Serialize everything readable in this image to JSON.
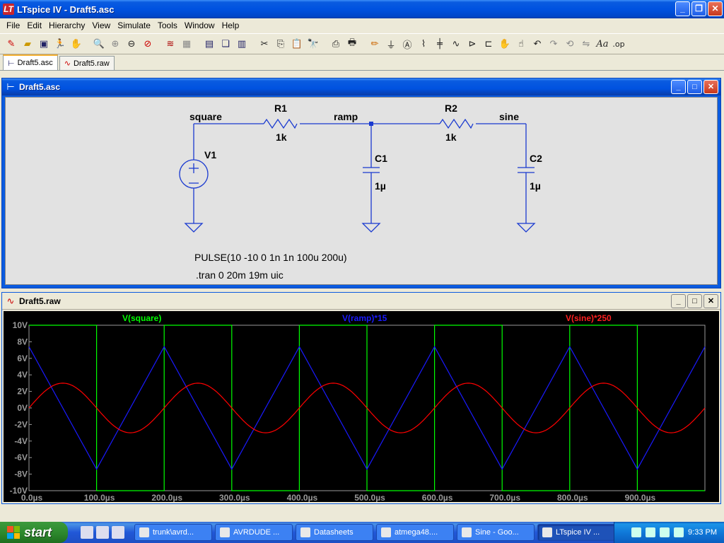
{
  "window": {
    "title": "LTspice IV - Draft5.asc",
    "logo": "LT"
  },
  "menu": [
    "File",
    "Edit",
    "Hierarchy",
    "View",
    "Simulate",
    "Tools",
    "Window",
    "Help"
  ],
  "toolbar_icons": [
    "new-schematic-icon",
    "open-icon",
    "save-icon",
    "run-icon",
    "halt-icon",
    "pan-icon",
    "zoom-in-icon",
    "zoom-area-icon",
    "zoom-out-icon",
    "zoom-cancel-icon",
    "autorange-icon",
    "grid-icon",
    "tile-horizontal-icon",
    "cascade-icon",
    "tile-vertical-icon",
    "cut-icon",
    "copy-icon",
    "paste-icon",
    "find-icon",
    "print-setup-icon",
    "print-icon",
    "wire-icon",
    "ground-icon",
    "label-icon",
    "resistor-icon",
    "capacitor-icon",
    "inductor-icon",
    "diode-icon",
    "component-icon",
    "move-icon",
    "drag-icon",
    "undo-icon",
    "redo-icon",
    "rotate-icon",
    "mirror-icon",
    "text-icon",
    "spice-directive-icon"
  ],
  "toolbar_text_text": "Aa",
  "toolbar_op_text": ".op",
  "tabs": [
    {
      "label": "Draft5.asc"
    },
    {
      "label": "Draft5.raw"
    }
  ],
  "schematic": {
    "title": "Draft5.asc",
    "nets": {
      "square": "square",
      "ramp": "ramp",
      "sine": "sine"
    },
    "components": {
      "R1": {
        "name": "R1",
        "value": "1k"
      },
      "R2": {
        "name": "R2",
        "value": "1k"
      },
      "C1": {
        "name": "C1",
        "value": "1µ"
      },
      "C2": {
        "name": "C2",
        "value": "1µ"
      },
      "V1": {
        "name": "V1"
      }
    },
    "source_directive": "PULSE(10 -10 0 1n 1n 100u 200u)",
    "tran_directive": ".tran 0 20m 19m uic"
  },
  "waveform": {
    "title": "Draft5.raw",
    "traces": [
      {
        "label": "V(square)",
        "color": "#00ff00"
      },
      {
        "label": "V(ramp)*15",
        "color": "#0000ff"
      },
      {
        "label": "V(sine)*250",
        "color": "#ff0000"
      }
    ]
  },
  "chart_data": {
    "type": "line",
    "x_unit": "µs",
    "xlim": [
      0,
      1000
    ],
    "ylim": [
      -10,
      10
    ],
    "x_ticks": [
      "0.0µs",
      "100.0µs",
      "200.0µs",
      "300.0µs",
      "400.0µs",
      "500.0µs",
      "600.0µs",
      "700.0µs",
      "800.0µs",
      "900.0µs"
    ],
    "y_ticks": [
      "10V",
      "8V",
      "6V",
      "4V",
      "2V",
      "0V",
      "-2V",
      "-4V",
      "-6V",
      "-8V",
      "-10V"
    ],
    "series": [
      {
        "name": "V(square)",
        "color": "#00ff00",
        "x": [
          0,
          100,
          100,
          200,
          200,
          300,
          300,
          400,
          400,
          500,
          500,
          600,
          600,
          700,
          700,
          800,
          800,
          900,
          900,
          1000
        ],
        "y": [
          10,
          10,
          -10,
          -10,
          10,
          10,
          -10,
          -10,
          10,
          10,
          -10,
          -10,
          10,
          10,
          -10,
          -10,
          10,
          10,
          -10,
          -10
        ]
      },
      {
        "name": "V(ramp)*15",
        "color": "#0000ff",
        "x": [
          0,
          100,
          200,
          300,
          400,
          500,
          600,
          700,
          800,
          900,
          1000
        ],
        "y": [
          7.4,
          -7.4,
          7.4,
          -7.4,
          7.4,
          -7.4,
          7.4,
          -7.4,
          7.4,
          -7.4,
          7.4
        ]
      },
      {
        "name": "V(sine)*250",
        "color": "#ff0000",
        "type": "sine",
        "amplitude": 3.0,
        "period_us": 200,
        "zero_crossing_us": 0
      }
    ]
  },
  "taskbar": {
    "start_label": "start",
    "tasks": [
      "trunk\\avrd...",
      "AVRDUDE ...",
      "Datasheets",
      "atmega48....",
      "Sine - Goo...",
      "LTspice IV ..."
    ],
    "clock": "9:33 PM"
  }
}
